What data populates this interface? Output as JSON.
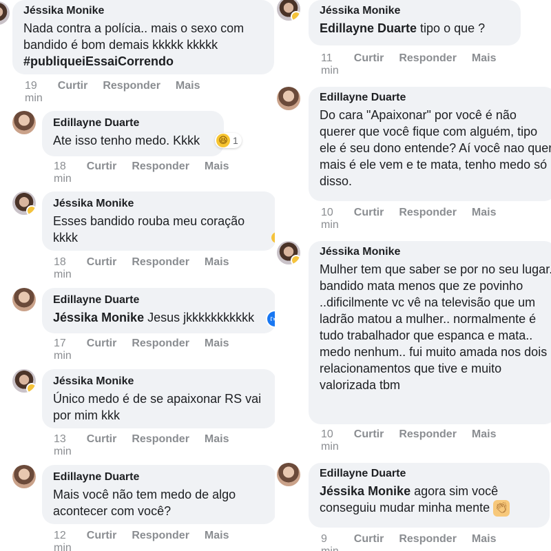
{
  "left": [
    {
      "author": "Jéssika Monike",
      "text": "Nada contra a polícia.. mais o sexo com bandido é bom demais kkkkk kkkkk",
      "hashtag": "#publiqueiEssaiCorrendo",
      "time": "19 min",
      "like": "Curtir",
      "reply": "Responder",
      "more": "Mais"
    },
    {
      "author": "Edillayne Duarte",
      "text": "Ate isso tenho medo. Kkkk",
      "reaction_count": "1",
      "time": "18 min",
      "like": "Curtir",
      "reply": "Responder",
      "more": "Mais"
    },
    {
      "author": "Jéssika Monike",
      "text": "Esses bandido rouba meu coração kkkk",
      "time": "18 min",
      "like": "Curtir",
      "reply": "Responder",
      "more": "Mais"
    },
    {
      "author": "Edillayne Duarte",
      "mention": "Jéssika Monike",
      "text": " Jesus jkkkkkkkkkkk",
      "time": "17 min",
      "like": "Curtir",
      "reply": "Responder",
      "more": "Mais"
    },
    {
      "author": "Jéssika Monike",
      "text": "Único medo é de se apaixonar RS vai por mim kkk",
      "time": "13 min",
      "like": "Curtir",
      "reply": "Responder",
      "more": "Mais"
    },
    {
      "author": "Edillayne Duarte",
      "text": "Mais você não tem medo de algo acontecer com você?",
      "time": "12 min",
      "like": "Curtir",
      "reply": "Responder",
      "more": "Mais"
    }
  ],
  "right": [
    {
      "author": "Jéssika Monike",
      "mention": "Edillayne Duarte",
      "text": " tipo o que ?",
      "time": "11 min",
      "like": "Curtir",
      "reply": "Responder",
      "more": "Mais"
    },
    {
      "author": "Edillayne Duarte",
      "text": "Do cara \"Apaixonar\" por você é não querer que você fique com alguém, tipo ele é seu dono entende? Aí você nao quer mais é ele vem e te mata, tenho medo só disso.",
      "time": "10 min",
      "like": "Curtir",
      "reply": "Responder",
      "more": "Mais"
    },
    {
      "author": "Jéssika Monike",
      "text": "Mulher tem que saber se por no seu lugar.. bandido mata menos que ze povinho ..dificilmente vc vê na televisão que um ladrão matou a mulher.. normalmente é tudo trabalhador que espanca e mata.. medo nenhum.. fui muito amada nos dois relacionamentos que tive e muito valorizada tbm",
      "time": "10 min",
      "like": "Curtir",
      "reply": "Responder",
      "more": "Mais"
    },
    {
      "author": "Edillayne Duarte",
      "mention": "Jéssika Monike",
      "text": " agora sim você conseguiu mudar minha mente",
      "time": "9 min",
      "like": "Curtir",
      "reply": "Responder",
      "more": "Mais"
    }
  ],
  "colors": {
    "bubble": "#f0f2f5",
    "meta": "#8a8d91",
    "text": "#1c1e21",
    "like_blue": "#1877f2"
  },
  "icons": {
    "laugh": "laughing-face-icon",
    "like": "thumbs-up-icon",
    "clap": "clapping-hands-icon"
  }
}
